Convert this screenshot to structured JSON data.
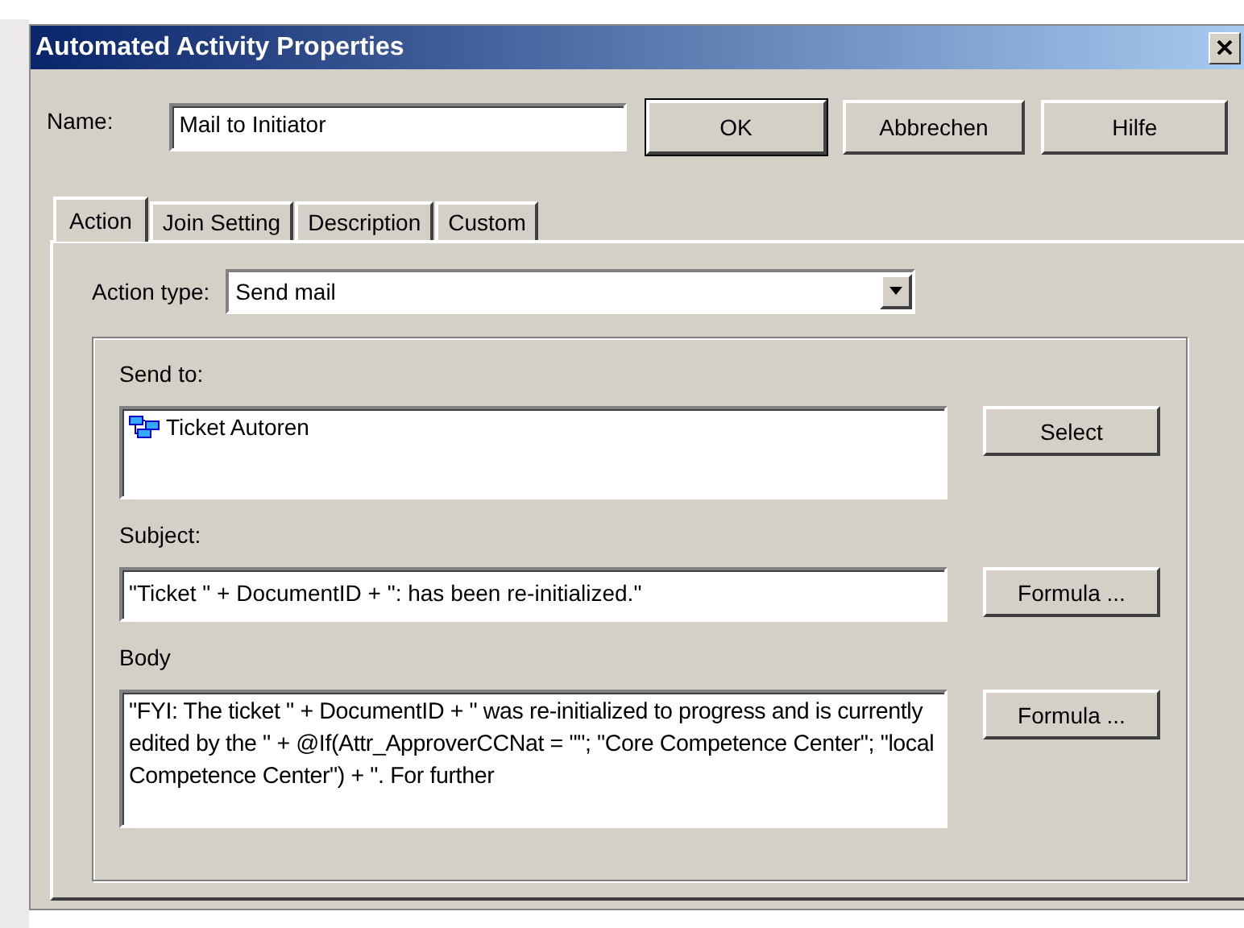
{
  "window": {
    "title": "Automated Activity Properties"
  },
  "name": {
    "label": "Name:",
    "value": "Mail to Initiator"
  },
  "buttons": [
    {
      "label": "OK",
      "default": true
    },
    {
      "label": "Abbrechen",
      "default": false
    },
    {
      "label": "Hilfe",
      "default": false
    }
  ],
  "tabs": [
    {
      "label": "Action",
      "selected": true
    },
    {
      "label": "Join Setting",
      "selected": false
    },
    {
      "label": "Description",
      "selected": false
    },
    {
      "label": "Custom",
      "selected": false
    }
  ],
  "action_type": {
    "label": "Action type:",
    "value": "Send mail"
  },
  "send_to": {
    "label": "Send to:",
    "items": [
      "Ticket Autoren"
    ],
    "button": "Select"
  },
  "subject": {
    "label": "Subject:",
    "value": "\"Ticket \" + DocumentID + \": has been re-initialized.\"",
    "button": "Formula ..."
  },
  "body": {
    "label": "Body",
    "value": "\"FYI: The ticket \" + DocumentID + \" was re-initialized to progress and is currently edited by the \" + @If(Attr_ApproverCCNat = \"\";  \"Core Competence Center\"; \"local Competence Center\") + \". For further",
    "button": "Formula ..."
  }
}
